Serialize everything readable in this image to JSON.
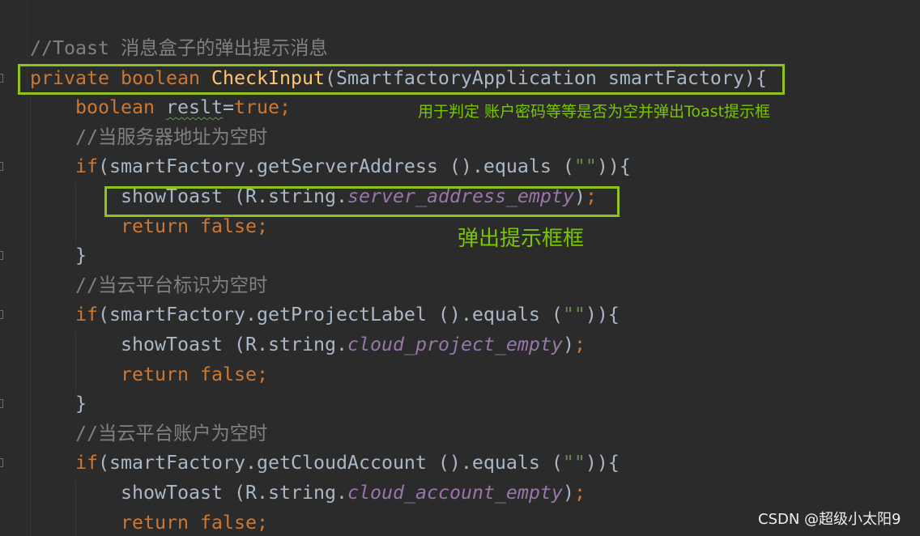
{
  "colors": {
    "background": "#2b2b2b",
    "keyword": "#cc7832",
    "method": "#ffc66d",
    "plain": "#a9b7c6",
    "comment": "#808080",
    "string": "#6a8759",
    "field": "#9876aa",
    "highlight_box": "#8dc21f",
    "annotation_text": "#79c500",
    "watermark": "#eeeeee"
  },
  "lines": [
    {
      "indent": 0,
      "fold": false,
      "tokens": [
        {
          "text": "//Toast 消息盒子的弹出提示消息",
          "kind": "comment"
        }
      ]
    },
    {
      "indent": 0,
      "fold": true,
      "tokens": [
        {
          "text": "private",
          "kind": "keyword"
        },
        {
          "text": " ",
          "kind": "plain"
        },
        {
          "text": "boolean",
          "kind": "keyword"
        },
        {
          "text": " ",
          "kind": "plain"
        },
        {
          "text": "CheckInput",
          "kind": "method"
        },
        {
          "text": "(SmartfactoryApplication smartFactory){",
          "kind": "plain"
        }
      ]
    },
    {
      "indent": 1,
      "fold": false,
      "tokens": [
        {
          "text": "boolean",
          "kind": "keyword"
        },
        {
          "text": " ",
          "kind": "plain"
        },
        {
          "text": "reslt",
          "kind": "typo"
        },
        {
          "text": "=",
          "kind": "plain"
        },
        {
          "text": "true",
          "kind": "keyword"
        },
        {
          "text": ";",
          "kind": "keyword"
        }
      ]
    },
    {
      "indent": 1,
      "fold": false,
      "tokens": [
        {
          "text": "//当服务器地址为空时",
          "kind": "comment"
        }
      ]
    },
    {
      "indent": 1,
      "fold": true,
      "tokens": [
        {
          "text": "if",
          "kind": "keyword"
        },
        {
          "text": "(smartFactory.getServerAddress ().equals (",
          "kind": "plain"
        },
        {
          "text": "\"\"",
          "kind": "string"
        },
        {
          "text": ")){",
          "kind": "plain"
        }
      ]
    },
    {
      "indent": 2,
      "fold": false,
      "tokens": [
        {
          "text": "showToast (R.string.",
          "kind": "plain"
        },
        {
          "text": "server_address_empty",
          "kind": "field"
        },
        {
          "text": ")",
          "kind": "plain"
        },
        {
          "text": ";",
          "kind": "keyword"
        }
      ]
    },
    {
      "indent": 2,
      "fold": false,
      "tokens": [
        {
          "text": "return false;",
          "kind": "keyword"
        }
      ]
    },
    {
      "indent": 1,
      "fold": true,
      "tokens": [
        {
          "text": "}",
          "kind": "plain"
        }
      ]
    },
    {
      "indent": 1,
      "fold": false,
      "tokens": [
        {
          "text": "//当云平台标识为空时",
          "kind": "comment"
        }
      ]
    },
    {
      "indent": 1,
      "fold": true,
      "tokens": [
        {
          "text": "if",
          "kind": "keyword"
        },
        {
          "text": "(smartFactory.getProjectLabel ().equals (",
          "kind": "plain"
        },
        {
          "text": "\"\"",
          "kind": "string"
        },
        {
          "text": ")){",
          "kind": "plain"
        }
      ]
    },
    {
      "indent": 2,
      "fold": false,
      "tokens": [
        {
          "text": "showToast (R.string.",
          "kind": "plain"
        },
        {
          "text": "cloud_project_empty",
          "kind": "field"
        },
        {
          "text": ")",
          "kind": "plain"
        },
        {
          "text": ";",
          "kind": "keyword"
        }
      ]
    },
    {
      "indent": 2,
      "fold": false,
      "tokens": [
        {
          "text": "return false;",
          "kind": "keyword"
        }
      ]
    },
    {
      "indent": 1,
      "fold": true,
      "tokens": [
        {
          "text": "}",
          "kind": "plain"
        }
      ]
    },
    {
      "indent": 1,
      "fold": false,
      "tokens": [
        {
          "text": "//当云平台账户为空时",
          "kind": "comment"
        }
      ]
    },
    {
      "indent": 1,
      "fold": true,
      "tokens": [
        {
          "text": "if",
          "kind": "keyword"
        },
        {
          "text": "(smartFactory.getCloudAccount ().equals (",
          "kind": "plain"
        },
        {
          "text": "\"\"",
          "kind": "string"
        },
        {
          "text": ")){",
          "kind": "plain"
        }
      ]
    },
    {
      "indent": 2,
      "fold": false,
      "tokens": [
        {
          "text": "showToast (R.string.",
          "kind": "plain"
        },
        {
          "text": "cloud_account_empty",
          "kind": "field"
        },
        {
          "text": ")",
          "kind": "plain"
        },
        {
          "text": ";",
          "kind": "keyword"
        }
      ]
    },
    {
      "indent": 2,
      "fold": false,
      "tokens": [
        {
          "text": "return false;",
          "kind": "keyword"
        }
      ]
    }
  ],
  "annotations": {
    "note_check": "用于判定 账户密码等等是否为空并弹出Toast提示框",
    "note_toast": "弹出提示框框"
  },
  "watermark": "CSDN @超级小太阳9"
}
